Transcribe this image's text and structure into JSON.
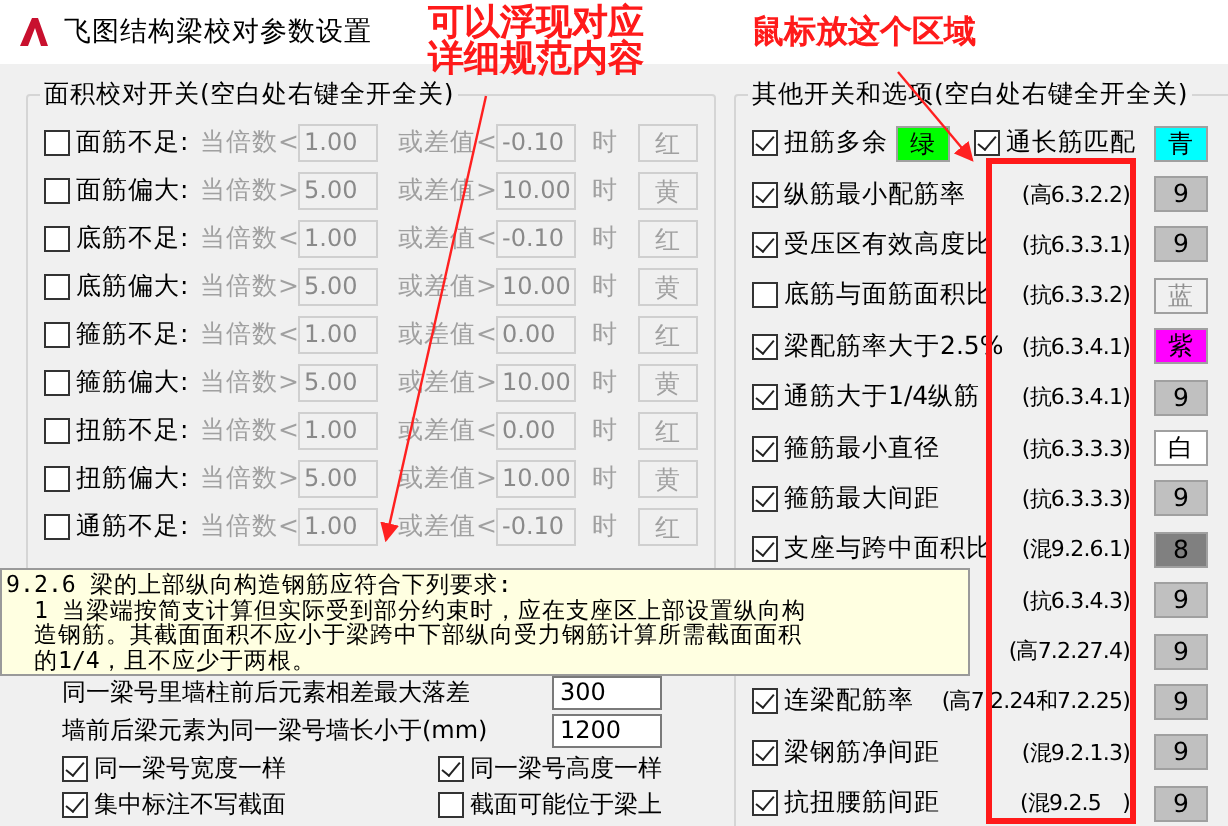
{
  "window": {
    "title": "飞图结构梁校对参数设置"
  },
  "annotations": {
    "left_note": [
      "可以浮现对应",
      "详细规范内容"
    ],
    "right_note": "鼠标放这个区域"
  },
  "area_check": {
    "title": "面积校对开关(空白处右键全开全关)",
    "rows": [
      {
        "label": "面筋不足:",
        "checked": false,
        "ratio_label": "当倍数<",
        "ratio": "1.00",
        "diff_label": "或差值<",
        "diff": "-0.10",
        "when": "时",
        "mark": "红"
      },
      {
        "label": "面筋偏大:",
        "checked": false,
        "ratio_label": "当倍数>",
        "ratio": "5.00",
        "diff_label": "或差值>",
        "diff": "10.00",
        "when": "时",
        "mark": "黄"
      },
      {
        "label": "底筋不足:",
        "checked": false,
        "ratio_label": "当倍数<",
        "ratio": "1.00",
        "diff_label": "或差值<",
        "diff": "-0.10",
        "when": "时",
        "mark": "红"
      },
      {
        "label": "底筋偏大:",
        "checked": false,
        "ratio_label": "当倍数>",
        "ratio": "5.00",
        "diff_label": "或差值>",
        "diff": "10.00",
        "when": "时",
        "mark": "黄"
      },
      {
        "label": "箍筋不足:",
        "checked": false,
        "ratio_label": "当倍数<",
        "ratio": "1.00",
        "diff_label": "或差值<",
        "diff": "0.00",
        "when": "时",
        "mark": "红"
      },
      {
        "label": "箍筋偏大:",
        "checked": false,
        "ratio_label": "当倍数>",
        "ratio": "5.00",
        "diff_label": "或差值>",
        "diff": "10.00",
        "when": "时",
        "mark": "黄"
      },
      {
        "label": "扭筋不足:",
        "checked": false,
        "ratio_label": "当倍数<",
        "ratio": "1.00",
        "diff_label": "或差值<",
        "diff": "0.00",
        "when": "时",
        "mark": "红"
      },
      {
        "label": "扭筋偏大:",
        "checked": false,
        "ratio_label": "当倍数>",
        "ratio": "5.00",
        "diff_label": "或差值>",
        "diff": "10.00",
        "when": "时",
        "mark": "黄"
      },
      {
        "label": "通筋不足:",
        "checked": false,
        "ratio_label": "当倍数<",
        "ratio": "1.00",
        "diff_label": "或差值<",
        "diff": "-0.10",
        "when": "时",
        "mark": "红"
      }
    ]
  },
  "beam_settings": {
    "fields": [
      {
        "label": "同一梁号里墙柱前后元素相差最大落差",
        "value": "300"
      },
      {
        "label": "墙前后梁元素为同一梁号墙长小于(mm)",
        "value": "1200"
      }
    ],
    "options": [
      {
        "label": "同一梁号宽度一样",
        "checked": true
      },
      {
        "label": "同一梁号高度一样",
        "checked": true
      },
      {
        "label": "集中标注不写截面",
        "checked": true
      },
      {
        "label": "截面可能位于梁上",
        "checked": false
      }
    ]
  },
  "other_options": {
    "title": "其他开关和选项(空白处右键全开全关)",
    "top_row": [
      {
        "label": "扭筋多余",
        "checked": true,
        "swatch": "绿",
        "color": "#00ff00"
      },
      {
        "label": "通长筋匹配",
        "checked": true,
        "swatch": "青",
        "color": "#00ffff"
      }
    ],
    "rows": [
      {
        "label": "纵筋最小配筋率",
        "checked": true,
        "code": "(高6.3.2.2)",
        "swatch": "9",
        "color": "#c0c0c0"
      },
      {
        "label": "受压区有效高度比",
        "checked": true,
        "code": "(抗6.3.3.1)",
        "swatch": "9",
        "color": "#c0c0c0"
      },
      {
        "label": "底筋与面筋面积比",
        "checked": false,
        "code": "(抗6.3.3.2)",
        "swatch": "蓝",
        "color": "#f0f0f0"
      },
      {
        "label": "梁配筋率大于2.5%",
        "checked": true,
        "code": "(抗6.3.4.1)",
        "swatch": "紫",
        "color": "#ff00ff"
      },
      {
        "label": "通筋大于1/4纵筋",
        "checked": true,
        "code": "(抗6.3.4.1)",
        "swatch": "9",
        "color": "#c0c0c0"
      },
      {
        "label": "箍筋最小直径",
        "checked": true,
        "code": "(抗6.3.3.3)",
        "swatch": "白",
        "color": "#ffffff"
      },
      {
        "label": "箍筋最大间距",
        "checked": true,
        "code": "(抗6.3.3.3)",
        "swatch": "9",
        "color": "#c0c0c0"
      },
      {
        "label": "支座与跨中面积比",
        "checked": true,
        "code": "(混9.2.6.1)",
        "swatch": "8",
        "color": "#808080"
      },
      {
        "code": "(抗6.3.4.3)",
        "swatch": "9",
        "color": "#c0c0c0"
      },
      {
        "code": "(高7.2.27.4)",
        "swatch": "9",
        "color": "#c0c0c0"
      },
      {
        "label": "连梁配筋率",
        "checked": true,
        "code": "(高7.2.24和7.2.25)",
        "swatch": "9",
        "color": "#c0c0c0"
      },
      {
        "label": "梁钢筋净间距",
        "checked": true,
        "code": "(混9.2.1.3)",
        "swatch": "9",
        "color": "#c0c0c0"
      },
      {
        "label": "抗扭腰筋间距",
        "checked": true,
        "code": "(混9.2.5　)",
        "swatch": "9",
        "color": "#c0c0c0"
      }
    ]
  },
  "tooltip": {
    "lines": [
      "9.2.6 梁的上部纵向构造钢筋应符合下列要求:",
      "  1 当梁端按简支计算但实际受到部分约束时，应在支座区上部设置纵向构",
      "  造钢筋。其截面面积不应小于梁跨中下部纵向受力钢筋计算所需截面面积",
      "  的1/4，且不应少于两根。"
    ]
  }
}
